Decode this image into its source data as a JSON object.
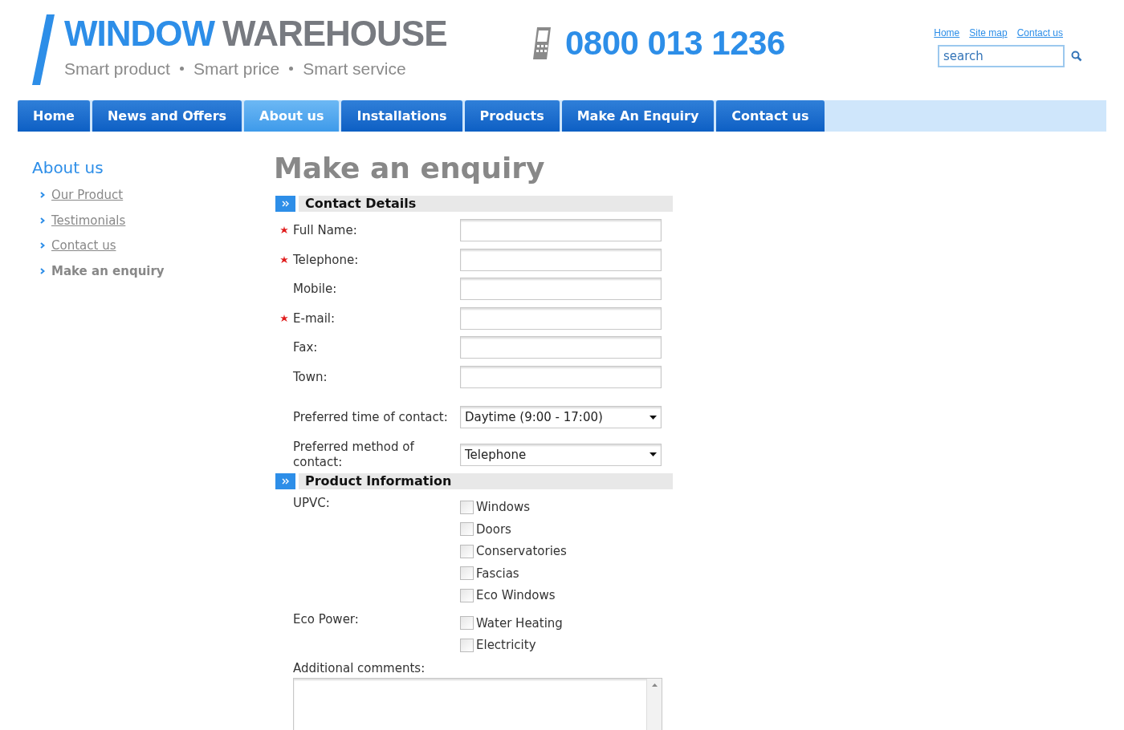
{
  "header": {
    "logo": {
      "word_1": "WINDOW",
      "word_2": "WAREHOUSE",
      "tagline": [
        "Smart product",
        "Smart price",
        "Smart service"
      ]
    },
    "phone": "0800 013 1236",
    "top_links": [
      "Home",
      "Site map",
      "Contact us"
    ],
    "search": {
      "placeholder": "search"
    }
  },
  "nav": [
    {
      "label": "Home",
      "selected": false
    },
    {
      "label": "News and Offers",
      "selected": false
    },
    {
      "label": "About us",
      "selected": true
    },
    {
      "label": "Installations",
      "selected": false
    },
    {
      "label": "Products",
      "selected": false
    },
    {
      "label": "Make An Enquiry",
      "selected": false
    },
    {
      "label": "Contact us",
      "selected": false
    }
  ],
  "sidebar": {
    "title": "About us",
    "items": [
      {
        "label": "Our Product",
        "selected": false
      },
      {
        "label": "Testimonials",
        "selected": false
      },
      {
        "label": "Contact us",
        "selected": false
      },
      {
        "label": "Make an enquiry",
        "selected": true
      }
    ]
  },
  "page_title": "Make an enquiry",
  "sections": [
    {
      "title": "Contact Details",
      "fields": [
        {
          "kind": "text",
          "label": "Full Name:",
          "required": true
        },
        {
          "kind": "text",
          "label": "Telephone:",
          "required": true
        },
        {
          "kind": "text",
          "label": "Mobile:",
          "required": false
        },
        {
          "kind": "text",
          "label": "E-mail:",
          "required": true
        },
        {
          "kind": "text",
          "label": "Fax:",
          "required": false
        },
        {
          "kind": "text",
          "label": "Town:",
          "required": false
        },
        {
          "kind": "select",
          "label": "Preferred time of contact:",
          "required": false,
          "value": "Daytime (9:00 - 17:00)"
        },
        {
          "kind": "select",
          "label": "Preferred method of contact:",
          "required": false,
          "value": "Telephone"
        }
      ]
    },
    {
      "title": "Product Information",
      "fields": [
        {
          "kind": "checkboxes",
          "label": "UPVC:",
          "required": false,
          "options": [
            {
              "label": "Windows",
              "checked": false
            },
            {
              "label": "Doors",
              "checked": false
            },
            {
              "label": "Conservatories",
              "checked": false
            },
            {
              "label": "Fascias",
              "checked": false
            },
            {
              "label": "Eco Windows",
              "checked": false
            }
          ]
        },
        {
          "kind": "checkboxes",
          "label": "Eco Power:",
          "required": false,
          "options": [
            {
              "label": "Water Heating",
              "checked": false
            },
            {
              "label": "Electricity",
              "checked": false
            }
          ]
        },
        {
          "kind": "textarea",
          "label": "Additional comments:",
          "required": false
        }
      ]
    }
  ]
}
